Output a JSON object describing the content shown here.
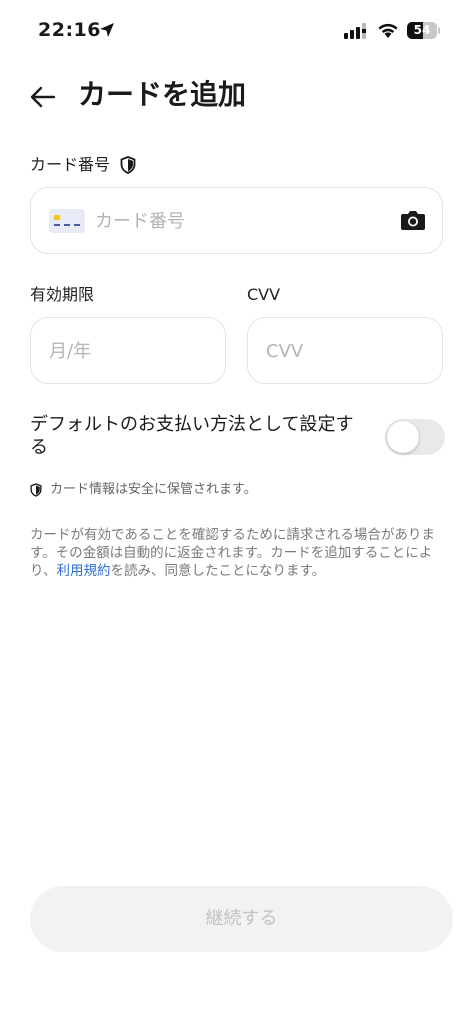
{
  "status_bar": {
    "time": "22:16",
    "battery_level": "54",
    "icons": [
      "location-arrow-icon",
      "cellular-signal-icon",
      "wifi-icon",
      "battery-icon"
    ]
  },
  "header": {
    "back_icon": "back-arrow-icon",
    "title": "カードを追加"
  },
  "card_number": {
    "label": "カード番号",
    "label_icon": "shield-icon",
    "placeholder": "カード番号",
    "value": "",
    "leading_icon": "credit-card-icon",
    "trailing_icon": "camera-icon"
  },
  "expiry": {
    "label": "有効期限",
    "placeholder": "月/年",
    "value": ""
  },
  "cvv": {
    "label": "CVV",
    "placeholder": "CVV",
    "value": ""
  },
  "default_payment": {
    "label": "デフォルトのお支払い方法として設定する",
    "enabled": false
  },
  "security_note": {
    "icon": "shield-icon",
    "text": "カード情報は安全に保管されます。"
  },
  "disclaimer": {
    "text_before": "カードが有効であることを確認するために請求される場合があります。その金額は自動的に返金されます。カードを追加することにより、",
    "link_text": "利用規約",
    "text_after": "を読み、同意したことになります。"
  },
  "continue_button": {
    "label": "継続する",
    "disabled": true
  },
  "colors": {
    "link": "#2f6fd6",
    "toggle_off": "#e9e9ea",
    "button_disabled_bg": "#f2f2f2",
    "button_disabled_text": "#c2c2c2",
    "card_chip": "#f5c518"
  }
}
